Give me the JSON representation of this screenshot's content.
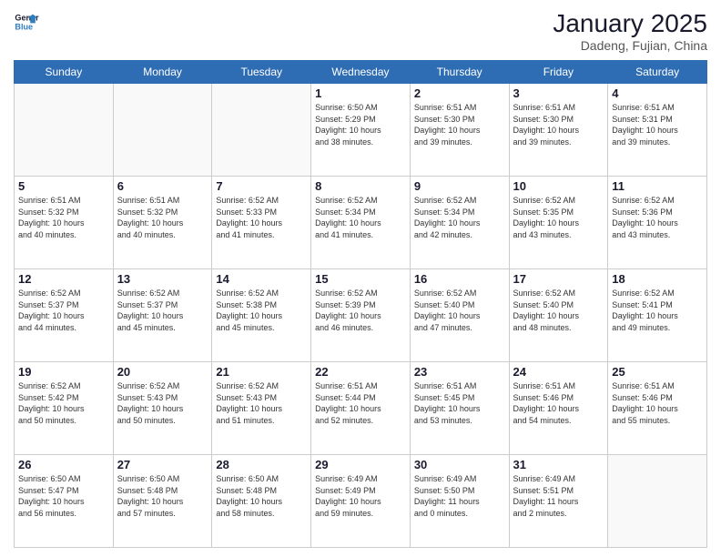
{
  "logo": {
    "line1": "General",
    "line2": "Blue"
  },
  "header": {
    "title": "January 2025",
    "subtitle": "Dadeng, Fujian, China"
  },
  "weekdays": [
    "Sunday",
    "Monday",
    "Tuesday",
    "Wednesday",
    "Thursday",
    "Friday",
    "Saturday"
  ],
  "weeks": [
    [
      {
        "day": "",
        "info": ""
      },
      {
        "day": "",
        "info": ""
      },
      {
        "day": "",
        "info": ""
      },
      {
        "day": "1",
        "info": "Sunrise: 6:50 AM\nSunset: 5:29 PM\nDaylight: 10 hours\nand 38 minutes."
      },
      {
        "day": "2",
        "info": "Sunrise: 6:51 AM\nSunset: 5:30 PM\nDaylight: 10 hours\nand 39 minutes."
      },
      {
        "day": "3",
        "info": "Sunrise: 6:51 AM\nSunset: 5:30 PM\nDaylight: 10 hours\nand 39 minutes."
      },
      {
        "day": "4",
        "info": "Sunrise: 6:51 AM\nSunset: 5:31 PM\nDaylight: 10 hours\nand 39 minutes."
      }
    ],
    [
      {
        "day": "5",
        "info": "Sunrise: 6:51 AM\nSunset: 5:32 PM\nDaylight: 10 hours\nand 40 minutes."
      },
      {
        "day": "6",
        "info": "Sunrise: 6:51 AM\nSunset: 5:32 PM\nDaylight: 10 hours\nand 40 minutes."
      },
      {
        "day": "7",
        "info": "Sunrise: 6:52 AM\nSunset: 5:33 PM\nDaylight: 10 hours\nand 41 minutes."
      },
      {
        "day": "8",
        "info": "Sunrise: 6:52 AM\nSunset: 5:34 PM\nDaylight: 10 hours\nand 41 minutes."
      },
      {
        "day": "9",
        "info": "Sunrise: 6:52 AM\nSunset: 5:34 PM\nDaylight: 10 hours\nand 42 minutes."
      },
      {
        "day": "10",
        "info": "Sunrise: 6:52 AM\nSunset: 5:35 PM\nDaylight: 10 hours\nand 43 minutes."
      },
      {
        "day": "11",
        "info": "Sunrise: 6:52 AM\nSunset: 5:36 PM\nDaylight: 10 hours\nand 43 minutes."
      }
    ],
    [
      {
        "day": "12",
        "info": "Sunrise: 6:52 AM\nSunset: 5:37 PM\nDaylight: 10 hours\nand 44 minutes."
      },
      {
        "day": "13",
        "info": "Sunrise: 6:52 AM\nSunset: 5:37 PM\nDaylight: 10 hours\nand 45 minutes."
      },
      {
        "day": "14",
        "info": "Sunrise: 6:52 AM\nSunset: 5:38 PM\nDaylight: 10 hours\nand 45 minutes."
      },
      {
        "day": "15",
        "info": "Sunrise: 6:52 AM\nSunset: 5:39 PM\nDaylight: 10 hours\nand 46 minutes."
      },
      {
        "day": "16",
        "info": "Sunrise: 6:52 AM\nSunset: 5:40 PM\nDaylight: 10 hours\nand 47 minutes."
      },
      {
        "day": "17",
        "info": "Sunrise: 6:52 AM\nSunset: 5:40 PM\nDaylight: 10 hours\nand 48 minutes."
      },
      {
        "day": "18",
        "info": "Sunrise: 6:52 AM\nSunset: 5:41 PM\nDaylight: 10 hours\nand 49 minutes."
      }
    ],
    [
      {
        "day": "19",
        "info": "Sunrise: 6:52 AM\nSunset: 5:42 PM\nDaylight: 10 hours\nand 50 minutes."
      },
      {
        "day": "20",
        "info": "Sunrise: 6:52 AM\nSunset: 5:43 PM\nDaylight: 10 hours\nand 50 minutes."
      },
      {
        "day": "21",
        "info": "Sunrise: 6:52 AM\nSunset: 5:43 PM\nDaylight: 10 hours\nand 51 minutes."
      },
      {
        "day": "22",
        "info": "Sunrise: 6:51 AM\nSunset: 5:44 PM\nDaylight: 10 hours\nand 52 minutes."
      },
      {
        "day": "23",
        "info": "Sunrise: 6:51 AM\nSunset: 5:45 PM\nDaylight: 10 hours\nand 53 minutes."
      },
      {
        "day": "24",
        "info": "Sunrise: 6:51 AM\nSunset: 5:46 PM\nDaylight: 10 hours\nand 54 minutes."
      },
      {
        "day": "25",
        "info": "Sunrise: 6:51 AM\nSunset: 5:46 PM\nDaylight: 10 hours\nand 55 minutes."
      }
    ],
    [
      {
        "day": "26",
        "info": "Sunrise: 6:50 AM\nSunset: 5:47 PM\nDaylight: 10 hours\nand 56 minutes."
      },
      {
        "day": "27",
        "info": "Sunrise: 6:50 AM\nSunset: 5:48 PM\nDaylight: 10 hours\nand 57 minutes."
      },
      {
        "day": "28",
        "info": "Sunrise: 6:50 AM\nSunset: 5:48 PM\nDaylight: 10 hours\nand 58 minutes."
      },
      {
        "day": "29",
        "info": "Sunrise: 6:49 AM\nSunset: 5:49 PM\nDaylight: 10 hours\nand 59 minutes."
      },
      {
        "day": "30",
        "info": "Sunrise: 6:49 AM\nSunset: 5:50 PM\nDaylight: 11 hours\nand 0 minutes."
      },
      {
        "day": "31",
        "info": "Sunrise: 6:49 AM\nSunset: 5:51 PM\nDaylight: 11 hours\nand 2 minutes."
      },
      {
        "day": "",
        "info": ""
      }
    ]
  ]
}
